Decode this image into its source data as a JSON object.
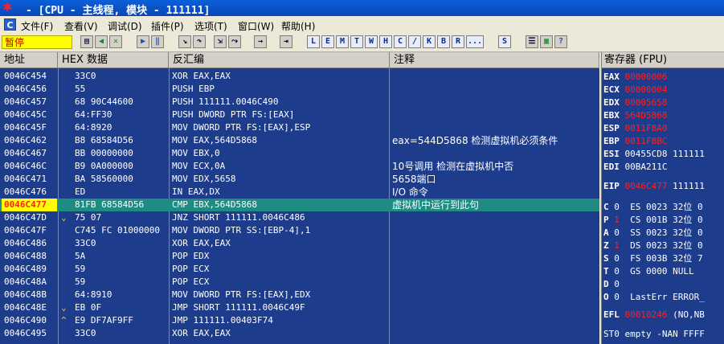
{
  "window": {
    "title": "- [CPU - 主线程, 模块 - 111111]",
    "app_icon": "x-bug-icon"
  },
  "menu": {
    "icon_label": "C",
    "items": [
      "文件(F)",
      "查看(V)",
      "调试(D)",
      "插件(P)",
      "选项(T)",
      "窗口(W)",
      "帮助(H)"
    ]
  },
  "toolbar": {
    "status": "暂停",
    "nav_buttons": [
      "open",
      "rewind",
      "close",
      "run",
      "pause",
      "step-into",
      "step-over",
      "trace-into",
      "trace-over",
      "execute-till-return",
      "go-to"
    ],
    "letter_buttons": [
      "L",
      "E",
      "M",
      "T",
      "W",
      "H",
      "C",
      "/",
      "K",
      "B",
      "R",
      "...",
      "S"
    ],
    "extra_buttons": [
      "list",
      "grid",
      "help"
    ]
  },
  "columns": {
    "address": "地址",
    "hex": "HEX 数据",
    "disasm": "反汇编",
    "comment": "注释"
  },
  "rows": [
    {
      "addr": "0046C454",
      "hex": "33C0",
      "asm": "XOR EAX,EAX",
      "comment": ""
    },
    {
      "addr": "0046C456",
      "hex": "55",
      "asm": "PUSH EBP",
      "comment": ""
    },
    {
      "addr": "0046C457",
      "hex": "68 90C44600",
      "asm": "PUSH 111111.0046C490",
      "comment": ""
    },
    {
      "addr": "0046C45C",
      "hex": "64:FF30",
      "asm": "PUSH DWORD PTR FS:[EAX]",
      "comment": ""
    },
    {
      "addr": "0046C45F",
      "hex": "64:8920",
      "asm": "MOV DWORD PTR FS:[EAX],ESP",
      "comment": ""
    },
    {
      "addr": "0046C462",
      "hex": "B8 68584D56",
      "asm": "MOV EAX,564D5868",
      "comment": "eax=544D5868 检测虚拟机必须条件"
    },
    {
      "addr": "0046C467",
      "hex": "BB 00000000",
      "asm": "MOV EBX,0",
      "comment": ""
    },
    {
      "addr": "0046C46C",
      "hex": "B9 0A000000",
      "asm": "MOV ECX,0A",
      "comment": "10号调用 检测在虚拟机中否"
    },
    {
      "addr": "0046C471",
      "hex": "BA 58560000",
      "asm": "MOV EDX,5658",
      "comment": "5658端口"
    },
    {
      "addr": "0046C476",
      "hex": "ED",
      "asm": "IN EAX,DX",
      "comment": "I/O 命令"
    },
    {
      "addr": "0046C477",
      "hex": "81FB 68584D56",
      "asm": "CMP EBX,564D5868",
      "comment": "虚拟机中运行到此句",
      "selected": true
    },
    {
      "addr": "0046C47D",
      "hex": "75 07",
      "asm": "JNZ SHORT 111111.0046C486",
      "comment": "",
      "jump": "⌄"
    },
    {
      "addr": "0046C47F",
      "hex": "C745 FC 01000000",
      "asm": "MOV DWORD PTR SS:[EBP-4],1",
      "comment": ""
    },
    {
      "addr": "0046C486",
      "hex": "33C0",
      "asm": "XOR EAX,EAX",
      "comment": ""
    },
    {
      "addr": "0046C488",
      "hex": "5A",
      "asm": "POP EDX",
      "comment": ""
    },
    {
      "addr": "0046C489",
      "hex": "59",
      "asm": "POP ECX",
      "comment": ""
    },
    {
      "addr": "0046C48A",
      "hex": "59",
      "asm": "POP ECX",
      "comment": ""
    },
    {
      "addr": "0046C48B",
      "hex": "64:8910",
      "asm": "MOV DWORD PTR FS:[EAX],EDX",
      "comment": ""
    },
    {
      "addr": "0046C48E",
      "hex": "EB 0F",
      "asm": "JMP SHORT 111111.0046C49F",
      "comment": "",
      "jump": "⌄"
    },
    {
      "addr": "0046C490",
      "hex": "E9 DF7AF9FF",
      "asm": "JMP 111111.00403F74",
      "comment": "",
      "jump": "^"
    },
    {
      "addr": "0046C495",
      "hex": "33C0",
      "asm": "XOR EAX,EAX",
      "comment": ""
    }
  ],
  "registers": {
    "header": "寄存器 (FPU)",
    "general": [
      {
        "name": "EAX",
        "value": "00000006",
        "changed": true
      },
      {
        "name": "ECX",
        "value": "00000004",
        "changed": true
      },
      {
        "name": "EDX",
        "value": "00005658",
        "changed": true
      },
      {
        "name": "EBX",
        "value": "564D5868",
        "changed": true
      },
      {
        "name": "ESP",
        "value": "0011F8A0",
        "changed": true
      },
      {
        "name": "EBP",
        "value": "0011F8BC",
        "changed": true
      },
      {
        "name": "ESI",
        "value": "00455CD8 111111",
        "changed": false
      },
      {
        "name": "EDI",
        "value": "00BA211C",
        "changed": false
      }
    ],
    "eip": {
      "name": "EIP",
      "value": "0046C477",
      "extra": "111111"
    },
    "flags": [
      {
        "flag": "C",
        "bit": "0",
        "seg": "ES 0023 32位 0",
        "changed": false
      },
      {
        "flag": "P",
        "bit": "1",
        "seg": "CS 001B 32位 0",
        "changed": true
      },
      {
        "flag": "A",
        "bit": "0",
        "seg": "SS 0023 32位 0",
        "changed": false
      },
      {
        "flag": "Z",
        "bit": "1",
        "seg": "DS 0023 32位 0",
        "changed": true
      },
      {
        "flag": "S",
        "bit": "0",
        "seg": "FS 003B 32位 7",
        "changed": false
      },
      {
        "flag": "T",
        "bit": "0",
        "seg": "GS 0000 NULL",
        "changed": false
      },
      {
        "flag": "D",
        "bit": "0",
        "seg": "",
        "changed": false
      },
      {
        "flag": "O",
        "bit": "0",
        "seg": "LastErr ERROR_",
        "changed": false
      }
    ],
    "efl": {
      "name": "EFL",
      "value": "00010246",
      "extra": "(NO,NB"
    },
    "st0": "ST0 empty -NAN FFFF"
  },
  "colors": {
    "pane_bg": "#1e3c8c",
    "selected_row": "#1f8c84",
    "changed_value": "#ff2020",
    "status_bg": "#ffff00"
  }
}
